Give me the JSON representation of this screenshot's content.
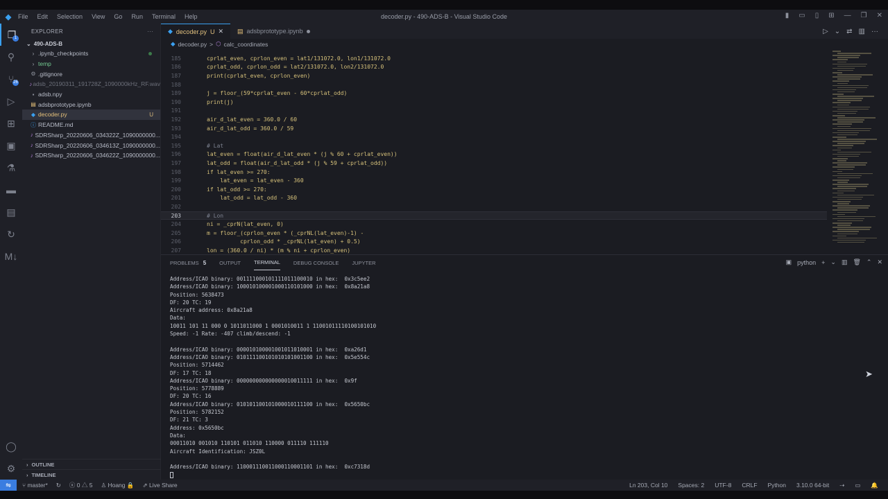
{
  "window": {
    "title": "decoder.py - 490-ADS-B - Visual Studio Code",
    "menu": [
      "File",
      "Edit",
      "Selection",
      "View",
      "Go",
      "Run",
      "Terminal",
      "Help"
    ]
  },
  "activity_bar": {
    "explorer_badge": "1",
    "source_control_badge": "26"
  },
  "sidebar": {
    "header": "EXPLORER",
    "more": "···",
    "project": "490-ADS-B",
    "files": [
      {
        "name": ".ipynb_checkpoints",
        "icon": "chevron-right-icon",
        "status": "",
        "dot": true
      },
      {
        "name": "temp",
        "icon": "chevron-right-icon",
        "status": "",
        "dot": false
      },
      {
        "name": ".gitignore",
        "icon": "gear-icon",
        "status": "",
        "dot": false
      },
      {
        "name": "adsb_20190311_191728Z_1090000kHz_RF.wav",
        "icon": "audio-file-icon",
        "status": "",
        "dot": false
      },
      {
        "name": "adsb.npy",
        "icon": "file-icon",
        "status": "",
        "dot": false
      },
      {
        "name": "adsbprototype.ipynb",
        "icon": "notebook-icon",
        "status": "",
        "dot": false
      },
      {
        "name": "decoder.py",
        "icon": "python-file-icon",
        "status": "U",
        "dot": false
      },
      {
        "name": "README.md",
        "icon": "info-icon",
        "status": "",
        "dot": false
      },
      {
        "name": "SDRSharp_20220606_034322Z_1090000000...",
        "icon": "audio-file-icon",
        "status": "",
        "dot": false
      },
      {
        "name": "SDRSharp_20220606_034613Z_1090000000...",
        "icon": "audio-file-icon",
        "status": "",
        "dot": false
      },
      {
        "name": "SDRSharp_20220606_034622Z_1090000000...",
        "icon": "audio-file-icon",
        "status": "",
        "dot": false
      }
    ],
    "outline": "OUTLINE",
    "timeline": "TIMELINE"
  },
  "tabs": [
    {
      "label": "decoder.py",
      "status": "U",
      "active": true
    },
    {
      "label": "adsbprototype.ipynb",
      "status": "",
      "active": false
    }
  ],
  "breadcrumb": {
    "file": "decoder.py",
    "sep": ">",
    "symbol": "calc_coordinates"
  },
  "editor": {
    "current_line": "203",
    "lines": [
      {
        "n": "185",
        "text": "cprlat_even, cprlon_even = lat1/131072.0, lon1/131072.0"
      },
      {
        "n": "186",
        "text": "cprlat_odd, cprlon_odd = lat2/131072.0, lon2/131072.0"
      },
      {
        "n": "187",
        "text": "print(cprlat_even, cprlon_even)"
      },
      {
        "n": "188",
        "text": ""
      },
      {
        "n": "189",
        "text": "j = floor_(59*cprlat_even - 60*cprlat_odd)"
      },
      {
        "n": "190",
        "text": "print(j)"
      },
      {
        "n": "191",
        "text": ""
      },
      {
        "n": "192",
        "text": "air_d_lat_even = 360.0 / 60"
      },
      {
        "n": "193",
        "text": "air_d_lat_odd = 360.0 / 59"
      },
      {
        "n": "194",
        "text": ""
      },
      {
        "n": "195",
        "text": "# Lat"
      },
      {
        "n": "196",
        "text": "lat_even = float(air_d_lat_even * (j % 60 + cprlat_even))"
      },
      {
        "n": "197",
        "text": "lat_odd = float(air_d_lat_odd * (j % 59 + cprlat_odd))"
      },
      {
        "n": "198",
        "text": "if lat_even >= 270:"
      },
      {
        "n": "199",
        "text": "    lat_even = lat_even - 360"
      },
      {
        "n": "200",
        "text": "if lat_odd >= 270:"
      },
      {
        "n": "201",
        "text": "    lat_odd = lat_odd - 360"
      },
      {
        "n": "202",
        "text": ""
      },
      {
        "n": "203",
        "text": "# Lon"
      },
      {
        "n": "204",
        "text": "ni = _cprN(lat_even, 0)"
      },
      {
        "n": "205",
        "text": "m = floor_(cprlon_even * (_cprNL(lat_even)-1) -"
      },
      {
        "n": "206",
        "text": "          cprlon_odd * _cprNL(lat_even) + 0.5)"
      },
      {
        "n": "207",
        "text": "lon = (360.0 / ni) * (m % ni + cprlon_even)"
      }
    ]
  },
  "panel": {
    "tabs": [
      "PROBLEMS",
      "OUTPUT",
      "TERMINAL",
      "DEBUG CONSOLE",
      "JUPYTER"
    ],
    "problems_count": "5",
    "active_tab": "TERMINAL",
    "shell": "python",
    "terminal_lines": [
      "Address/ICAO binary: 001111000101111011100010 in hex:  0x3c5ee2",
      "Address/ICAO binary: 100010100001000110101000 in hex:  0x8a21a8",
      "Position: 5638473",
      "DF: 20 TC: 19",
      "Aircraft address: 0x8a21a8",
      "Data:",
      "10011 101 11 000 0 1011011000 1 0001010011 1 11001011110100101010",
      "Speed: -1 Rate: -407 climb/descend: -1",
      "",
      "Address/ICAO binary: 000010100001001011010001 in hex:  0xa26d1",
      "Address/ICAO binary: 010111100101010101001100 in hex:  0x5e554c",
      "Position: 5714462",
      "DF: 17 TC: 18",
      "Address/ICAO binary: 000000000000000010011111 in hex:  0x9f",
      "Position: 5778889",
      "DF: 20 TC: 16",
      "Address/ICAO binary: 010101100101000010111100 in hex:  0x5650bc",
      "Position: 5782152",
      "DF: 21 TC: 3",
      "Address: 0x5650bc",
      "Data:",
      "00011010 001010 110101 011010 110000 011110 111110",
      "Aircraft Identification: JSZ0L",
      "",
      "Address/ICAO binary: 110001110011000110001101 in hex:  0xc7318d"
    ]
  },
  "statusbar": {
    "branch": "master*",
    "errors": "0",
    "warnings": "5",
    "user": "Hoang",
    "live_share": "Live Share",
    "position": "Ln 203, Col 10",
    "spaces": "Spaces: 2",
    "encoding": "UTF-8",
    "eol": "CRLF",
    "language": "Python",
    "interpreter": "3.10.0 64-bit"
  },
  "colors": {
    "accent": "#3aa0f0",
    "code": "#d6c17a",
    "modified": "#e4c07a"
  }
}
